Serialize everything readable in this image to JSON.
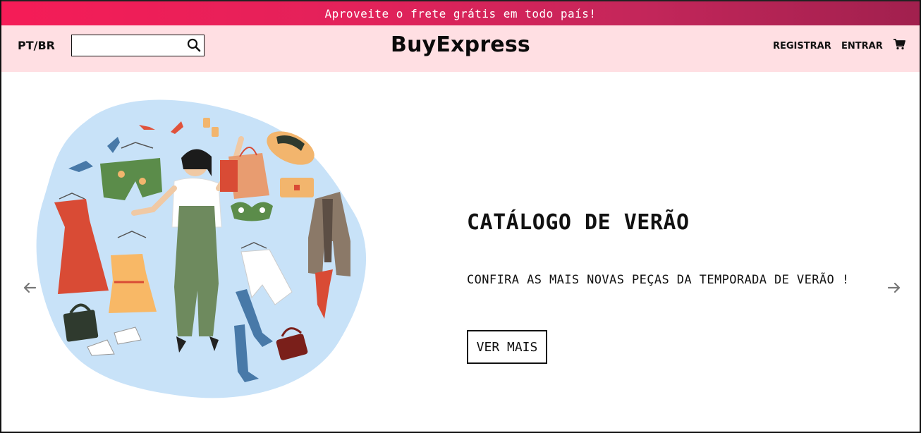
{
  "announcement": {
    "text": "Aproveite o frete grátis em todo país!"
  },
  "navbar": {
    "language": "PT/BR",
    "search": {
      "value": "",
      "placeholder": ""
    },
    "brand": "BuyExpress",
    "register_label": "REGISTRAR",
    "login_label": "ENTRAR",
    "cart_icon": "cart-icon"
  },
  "slide": {
    "title": "CATÁLOGO DE VERÃO",
    "description": "CONFIRA AS MAIS NOVAS PEÇAS DA TEMPORADA DE VERÃO !",
    "button_label": "VER MAIS",
    "image": "summer-clothes-illustration",
    "prev_icon": "arrow-left-icon",
    "next_icon": "arrow-right-icon"
  },
  "colors": {
    "announcement_start": "#f51c57",
    "announcement_end": "#a1204e",
    "navbar_bg": "#ffdfe3",
    "illustration_blob": "#c8e2f8"
  }
}
